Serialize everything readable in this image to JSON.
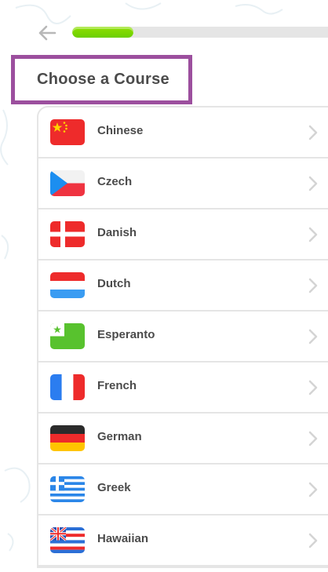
{
  "header": {
    "back_icon": "arrow-left-icon",
    "progress_fraction": 0.23
  },
  "title": "Choose a Course",
  "courses": [
    {
      "label": "Chinese",
      "flag_icon": "china-flag-icon"
    },
    {
      "label": "Czech",
      "flag_icon": "czech-flag-icon"
    },
    {
      "label": "Danish",
      "flag_icon": "denmark-flag-icon"
    },
    {
      "label": "Dutch",
      "flag_icon": "netherlands-flag-icon"
    },
    {
      "label": "Esperanto",
      "flag_icon": "esperanto-flag-icon"
    },
    {
      "label": "French",
      "flag_icon": "france-flag-icon"
    },
    {
      "label": "German",
      "flag_icon": "germany-flag-icon"
    },
    {
      "label": "Greek",
      "flag_icon": "greece-flag-icon"
    },
    {
      "label": "Hawaiian",
      "flag_icon": "hawaii-flag-icon"
    }
  ],
  "colors": {
    "progress_green": "#78c800",
    "highlight_purple": "#9c4f9e",
    "text_gray": "#4b4b4b"
  }
}
